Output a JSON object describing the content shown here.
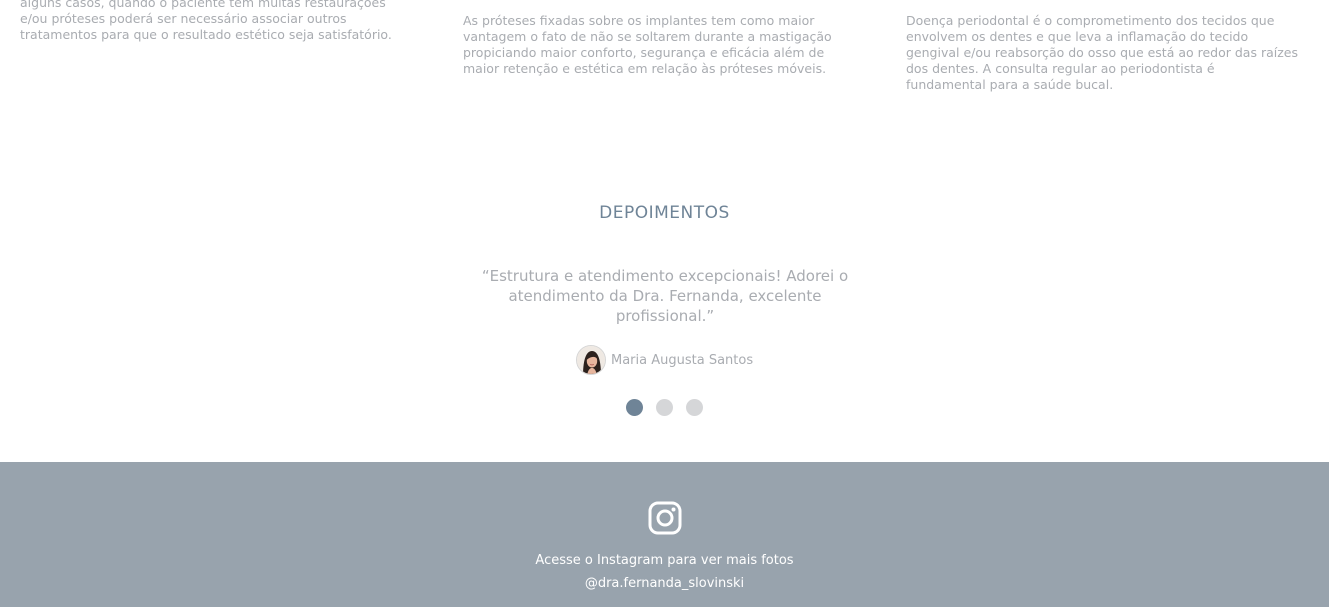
{
  "services": {
    "col1": "alguns casos, quando o paciente tem muitas restaurações\ne/ou próteses poderá ser necessário associar outros\ntratamentos para que o resultado estético seja satisfatório.",
    "col2": "As próteses fixadas sobre os implantes tem como maior\nvantagem o fato de não se soltarem durante a mastigação\npropiciando maior conforto, segurança e eficácia além de\nmaior retenção e estética em relação às próteses móveis.",
    "col3": "Doença periodontal é o comprometimento dos tecidos que\nenvolvem os dentes e que leva a inflamação do tecido\ngengival e/ou reabsorção do osso que está ao redor das raízes\ndos dentes. A consulta regular ao periodontista é\nfundamental para a saúde bucal."
  },
  "testimonials": {
    "title": "DEPOIMENTOS",
    "quote": "“Estrutura e atendimento excepcionais! Adorei o atendimento da Dra. Fernanda, excelente profissional.”",
    "author": "Maria Augusta Santos",
    "slides": 3,
    "active_slide": 1
  },
  "footer": {
    "icon": "instagram-icon",
    "text": "Acesse o Instagram para ver mais fotos",
    "handle": "@dra.fernanda_slovinski"
  },
  "colors": {
    "accent": "#6f8497",
    "footer_bg": "#98a3ad",
    "muted_text": "#a9acb1",
    "dot_inactive": "#d5d6d8"
  }
}
